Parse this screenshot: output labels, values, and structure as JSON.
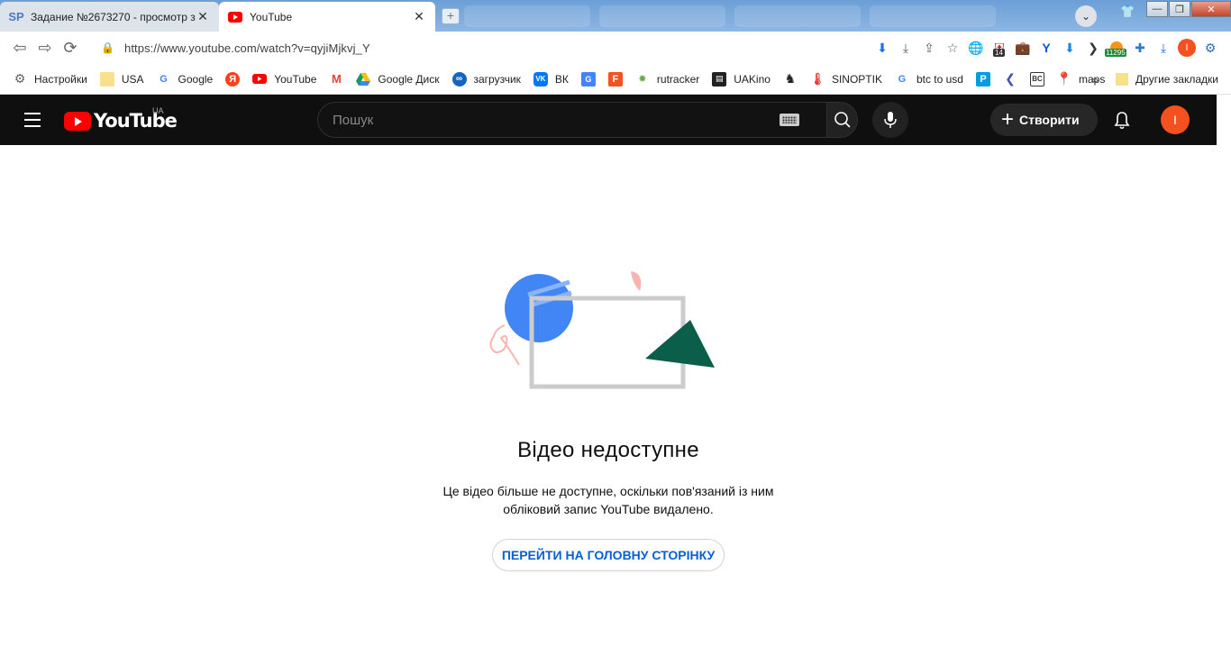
{
  "tabs": [
    {
      "title": "Задание №2673270 - просмотр з",
      "favicon_text": "SP"
    },
    {
      "title": "YouTube"
    }
  ],
  "address_bar": {
    "url": "https://www.youtube.com/watch?v=qyjiMjkvj_Y"
  },
  "extensions": {
    "badge_14": "14",
    "badge_11295": "11295",
    "profile_letter": "I"
  },
  "bookmarks": {
    "items": [
      {
        "label": "Настройки"
      },
      {
        "label": "USA"
      },
      {
        "label": "Google"
      },
      {
        "label": ""
      },
      {
        "label": "YouTube"
      },
      {
        "label": ""
      },
      {
        "label": "Google Диск"
      },
      {
        "label": "загрузчик"
      },
      {
        "label": "ВК"
      },
      {
        "label": ""
      },
      {
        "label": ""
      },
      {
        "label": "rutracker"
      },
      {
        "label": "UAKino"
      },
      {
        "label": ""
      },
      {
        "label": "SINOPTIK"
      },
      {
        "label": "btc to usd"
      },
      {
        "label": ""
      },
      {
        "label": ""
      },
      {
        "label": ""
      },
      {
        "label": "maps"
      }
    ],
    "more": "»",
    "other_label": "Другие закладки"
  },
  "youtube": {
    "logo_word": "YouTube",
    "region": "UA",
    "search_placeholder": "Пошук",
    "create_label": "Створити",
    "avatar_letter": "I"
  },
  "error": {
    "title": "Відео недоступне",
    "line1": "Це відео більше не доступне, оскільки пов'язаний із ним",
    "line2": "обліковий запис YouTube видалено.",
    "home_button": "ПЕРЕЙТИ НА ГОЛОВНУ СТОРІНКУ"
  },
  "colors": {
    "yt_red": "#ff0000",
    "header_bg": "#0f0f0f",
    "link_blue": "#065fd4",
    "avatar": "#f4511e",
    "illus_blue": "#4285f4",
    "illus_green": "#0b5e4a",
    "illus_pink": "#f8b4b0",
    "illus_frame": "#cccccc"
  }
}
